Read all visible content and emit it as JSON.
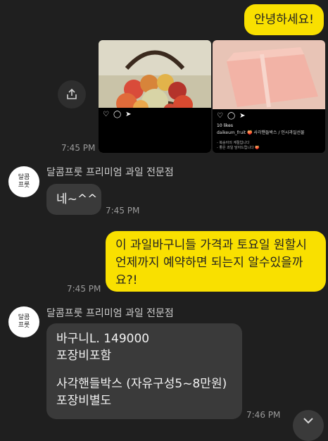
{
  "messages": {
    "greeting": "안녕하세요!",
    "image_time": "7:45 PM",
    "sender1": "달콤프룻 프리미엄 과일 전문점",
    "reply1": "네~^^",
    "reply1_time": "7:45 PM",
    "question": "이 과일바구니들 가격과 토요일 원할시 언제까지 예약하면 되는지 알수있을까요?!",
    "question_time": "7:45 PM",
    "sender2": "달콤프룻 프리미엄 과일 전문점",
    "answer_line1": "바구니L. 149000",
    "answer_line2": "포장비포함",
    "answer_line3": "사각핸들박스 (자유구성5~8만원)",
    "answer_line4": "포장비별도",
    "answer_time": "7:46 PM"
  },
  "instagram_post": {
    "likes": "10 likes",
    "caption": "daikeum_fruit 🍑 사각핸들박스 / 인시과일선물",
    "caption_line2": "- 복숭아의 계절입니다",
    "caption_line3": "- 좋은 과일 담아드립니다 🍑"
  },
  "avatar_text": "달콤 프룻",
  "colors": {
    "bubble_me": "#f9e000",
    "bubble_other": "#3a3a3a",
    "background": "#1f1f1f"
  }
}
